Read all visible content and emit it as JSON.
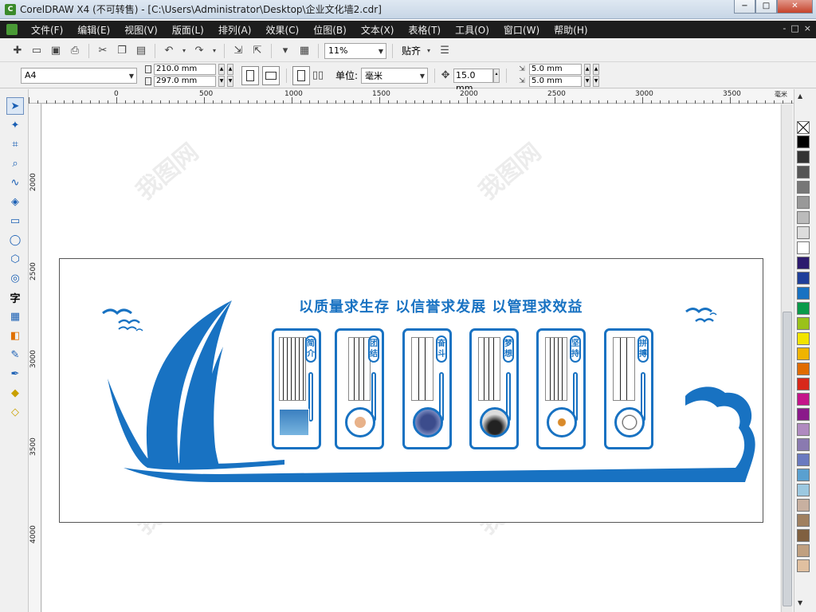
{
  "window": {
    "title": "CorelDRAW X4 (不可转售) - [C:\\Users\\Administrator\\Desktop\\企业文化墙2.cdr]",
    "controls": [
      "−",
      "□",
      "✕"
    ]
  },
  "menu": {
    "items": [
      "文件(F)",
      "编辑(E)",
      "视图(V)",
      "版面(L)",
      "排列(A)",
      "效果(C)",
      "位图(B)",
      "文本(X)",
      "表格(T)",
      "工具(O)",
      "窗口(W)",
      "帮助(H)"
    ],
    "doc_controls": [
      "-",
      "□",
      "×"
    ]
  },
  "toolbar": {
    "zoom": "11%",
    "snap_label": "贴齐"
  },
  "property_bar": {
    "paper_size": "A4",
    "width": "210.0 mm",
    "height": "297.0 mm",
    "unit_label": "单位:",
    "unit_value": "毫米",
    "nudge": "15.0 mm",
    "dup_x": "5.0 mm",
    "dup_y": "5.0 mm"
  },
  "ruler": {
    "top_labels": [
      "500",
      "0",
      "500",
      "1000",
      "1500",
      "2000",
      "2500",
      "3000",
      "3500"
    ],
    "top_unit": "毫米",
    "left_labels": [
      "2000",
      "2500",
      "3000",
      "3500",
      "4000"
    ]
  },
  "design": {
    "slogan": "以质量求生存  以信誉求发展  以管理求效益",
    "panels": [
      {
        "label": "简介"
      },
      {
        "label": "团结"
      },
      {
        "label": "奋斗"
      },
      {
        "label": "梦想"
      },
      {
        "label": "坚持"
      },
      {
        "label": "拼搏"
      }
    ],
    "accent_color": "#1872c2"
  },
  "watermark": "我图网"
}
